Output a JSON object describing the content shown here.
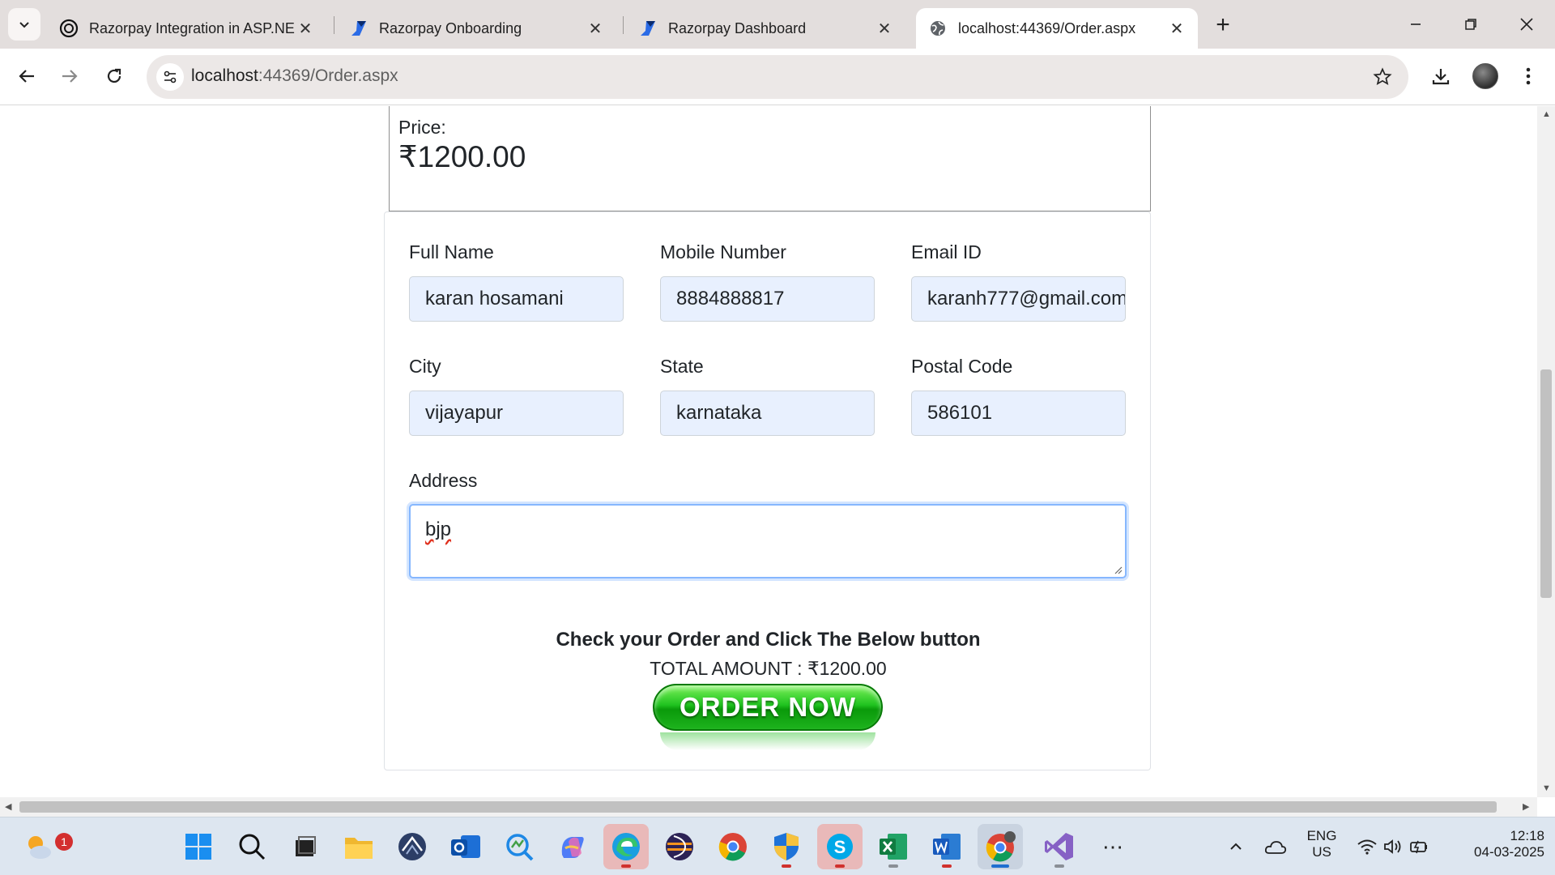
{
  "browser": {
    "tabs": [
      {
        "title": "Razorpay Integration in ASP.NE",
        "icon": "openai-icon",
        "active": false
      },
      {
        "title": "Razorpay Onboarding",
        "icon": "razorpay-icon",
        "active": false
      },
      {
        "title": "Razorpay Dashboard",
        "icon": "razorpay-icon",
        "active": false
      },
      {
        "title": "localhost:44369/Order.aspx",
        "icon": "globe-icon",
        "active": true
      }
    ],
    "close_glyph": "✕",
    "new_tab_glyph": "+",
    "url_host": "localhost",
    "url_rest": ":44369/Order.aspx"
  },
  "page": {
    "price_label": "Price:",
    "price_value": "₹1200.00",
    "fields": {
      "full_name": {
        "label": "Full Name",
        "value": "karan hosamani"
      },
      "mobile": {
        "label": "Mobile Number",
        "value": "8884888817"
      },
      "email": {
        "label": "Email ID",
        "value": "karanh777@gmail.com"
      },
      "city": {
        "label": "City",
        "value": "vijayapur"
      },
      "state": {
        "label": "State",
        "value": "karnataka"
      },
      "postal": {
        "label": "Postal Code",
        "value": "586101"
      },
      "address": {
        "label": "Address",
        "value": "bjp"
      }
    },
    "check_text": "Check your Order and Click The Below button",
    "total_text": "TOTAL AMOUNT : ₹1200.00",
    "order_button": "ORDER NOW"
  },
  "taskbar": {
    "weather_badge": "1",
    "lang_line1": "ENG",
    "lang_line2": "US",
    "time": "12:18",
    "date": "04-03-2025",
    "more_glyph": "⋯"
  },
  "colors": {
    "tabstrip_bg": "#e3dedd",
    "input_bg": "#e8f0fe",
    "focus_border": "#86b7fe",
    "order_button_green": "#1fc21f"
  }
}
